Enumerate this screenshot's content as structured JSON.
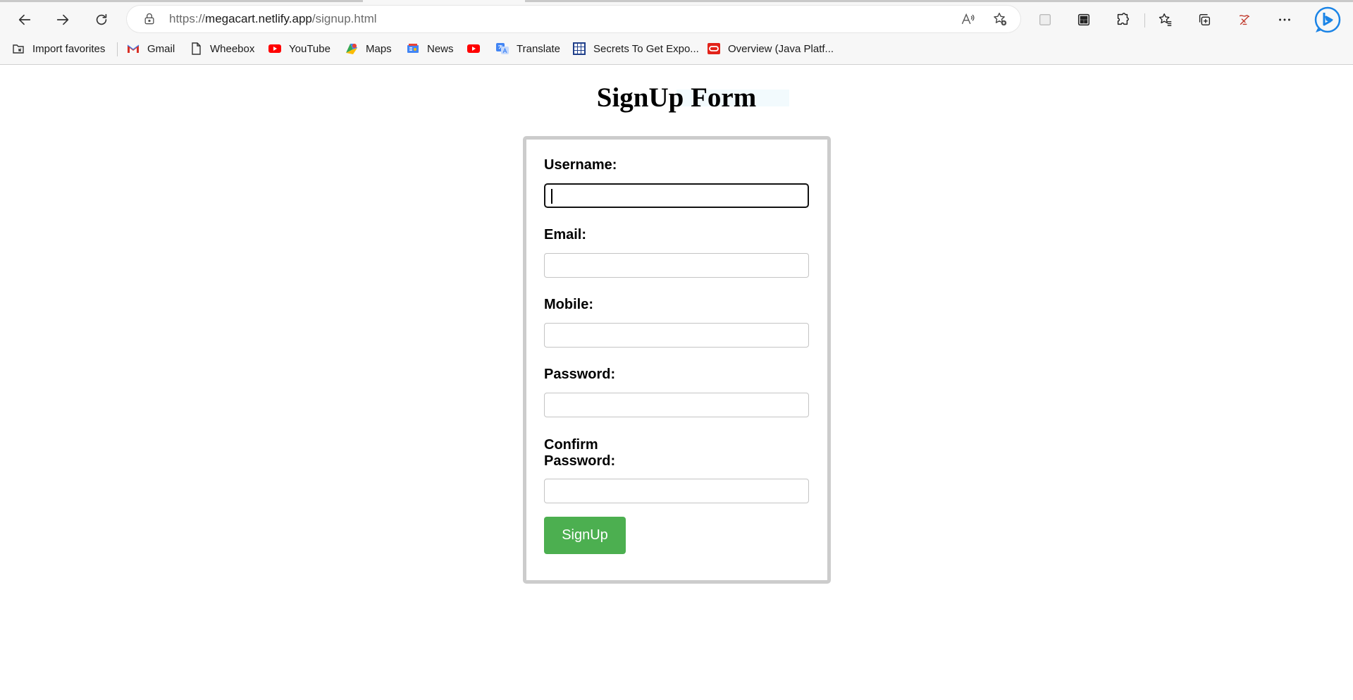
{
  "browser": {
    "url_prefix": "https://",
    "url_host": "megacart.netlify.app",
    "url_path": "/signup.html",
    "nav": {
      "back_icon": "arrow-left-icon",
      "forward_icon": "arrow-right-icon",
      "refresh_icon": "refresh-icon"
    },
    "favorites": [
      {
        "label": "Import favorites",
        "icon": "import-favorites-icon"
      },
      {
        "label": "Gmail",
        "icon": "gmail-icon"
      },
      {
        "label": "Wheebox",
        "icon": "page-icon"
      },
      {
        "label": "YouTube",
        "icon": "youtube-icon"
      },
      {
        "label": "Maps",
        "icon": "maps-icon"
      },
      {
        "label": "News",
        "icon": "news-icon"
      },
      {
        "label": "",
        "icon": "youtube-icon"
      },
      {
        "label": "Translate",
        "icon": "translate-icon"
      },
      {
        "label": "Secrets To Get Expo...",
        "icon": "grid-icon"
      },
      {
        "label": "Overview (Java Platf...",
        "icon": "oracle-icon"
      }
    ]
  },
  "form": {
    "title": "SignUp Form",
    "fields": [
      {
        "label": "Username:",
        "value": "",
        "focused": true
      },
      {
        "label": "Email:",
        "value": ""
      },
      {
        "label": "Mobile:",
        "value": ""
      },
      {
        "label": "Password:",
        "value": ""
      },
      {
        "label": "Confirm Password:",
        "value": ""
      }
    ],
    "submit_label": "SignUp",
    "colors": {
      "button": "#4caf50",
      "border": "#cccccc"
    }
  }
}
